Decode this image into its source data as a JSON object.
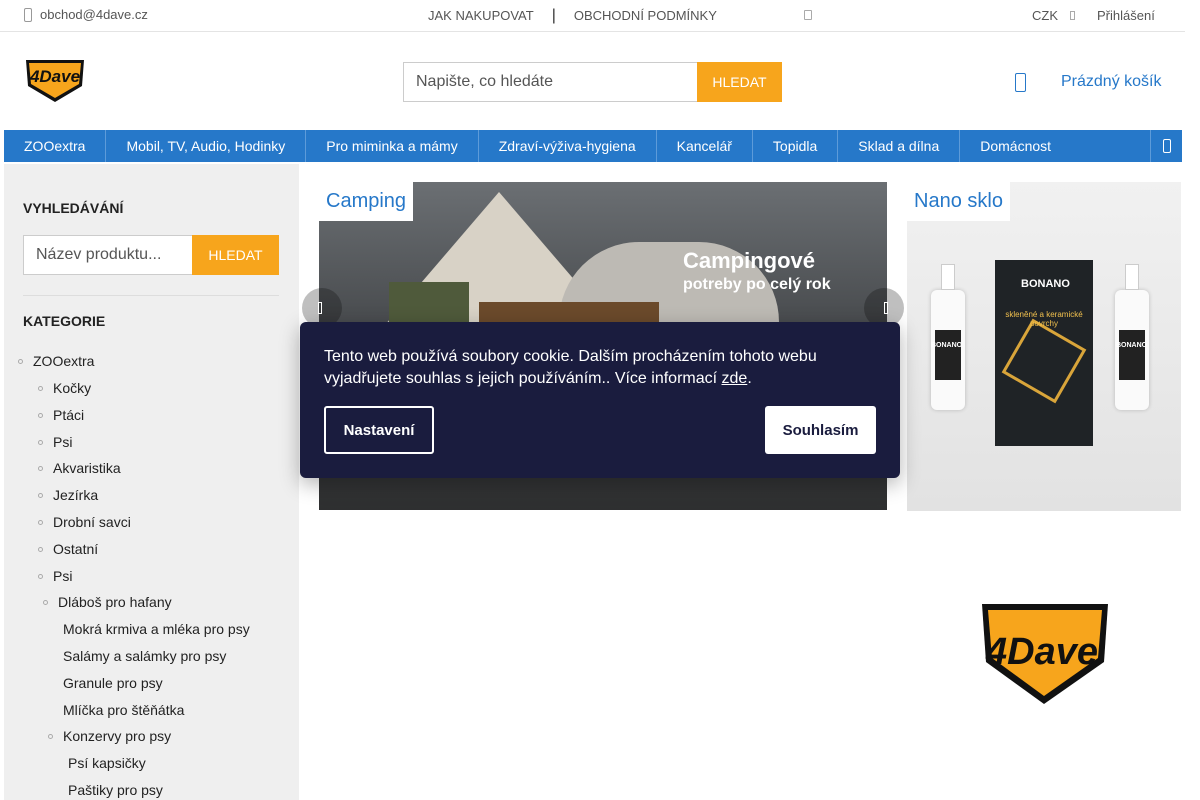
{
  "topbar": {
    "email": "obchod@4dave.cz",
    "link_how": "JAK NAKUPOVAT",
    "link_terms": "OBCHODNÍ PODMÍNKY",
    "currency": "CZK",
    "login": "Přihlášení"
  },
  "header": {
    "logo_text": "4Dave",
    "search_placeholder": "Napište, co hledáte",
    "search_button": "HLEDAT",
    "cart": "Prázdný košík"
  },
  "nav": {
    "items": [
      "ZOOextra",
      "Mobil, TV, Audio, Hodinky",
      "Pro miminka a mámy",
      "Zdraví-výživa-hygiena",
      "Kancelář",
      "Topidla",
      "Sklad a dílna",
      "Domácnost"
    ]
  },
  "sidebar": {
    "search_title": "VYHLEDÁVÁNÍ",
    "search_placeholder": "Název produktu...",
    "search_button": "HLEDAT",
    "categories_title": "KATEGORIE",
    "categories": [
      "ZOOextra",
      "Kočky",
      "Ptáci",
      "Psi",
      "Akvaristika",
      "Jezírka",
      "Drobní savci",
      "Ostatní",
      "Psi",
      "Dláboš pro hafany",
      "Mokrá krmiva a mléka pro psy",
      "Salámy a salámky pro psy",
      "Granule pro psy",
      "Mlíčka pro štěňátka",
      "Konzervy pro psy",
      "Psí kapsičky",
      "Paštiky pro psy"
    ]
  },
  "banners": {
    "camping_tag": "Camping",
    "camping_title": "Campingové",
    "camping_subtitle": "potreby po celý rok",
    "nano_tag": "Nano sklo",
    "nano_brand_left": "BONANO",
    "nano_brand_box": "BONANO",
    "nano_box_text": "skleněné a keramické povrchy",
    "nano_brand_right": "BONANO"
  },
  "cookie": {
    "message": "Tento web používá soubory cookie. Dalším procházením tohoto webu vyjadřujete souhlas s jejich používáním.. Více informací ",
    "link": "zde",
    "after_link": ".",
    "settings": "Nastavení",
    "accept": "Souhlasím"
  },
  "colors": {
    "brand_blue": "#2678c9",
    "accent_orange": "#f7a51c",
    "cookie_bg": "#1a1c3e"
  }
}
